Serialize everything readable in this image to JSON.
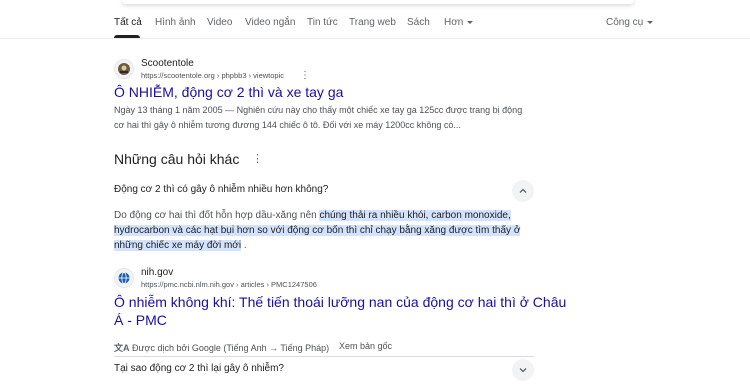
{
  "tabs": {
    "items": [
      {
        "label": "Tất cả"
      },
      {
        "label": "Hình ảnh"
      },
      {
        "label": "Video"
      },
      {
        "label": "Video ngắn"
      },
      {
        "label": "Tin tức"
      },
      {
        "label": "Trang web"
      },
      {
        "label": "Sách"
      },
      {
        "label": "Hơn"
      }
    ],
    "tools_label": "Công cụ"
  },
  "result1": {
    "site_name": "Scootentole",
    "url": "https://scootentole.org › phpbb3 › viewtopic",
    "title": "Ô NHIỄM, động cơ 2 thì và xe tay ga",
    "snippet_lines": [
      "Ngày 13 tháng 1 năm 2005 — Nghiên cứu này cho thấy một chiếc xe tay ga 125cc được trang bị động",
      "cơ hai thì gây ô nhiễm tương đương 144 chiếc ô tô. Đối với xe máy 1200cc không có..."
    ]
  },
  "paa": {
    "heading": "Những câu hỏi khác",
    "question1": "Động cơ 2 thì có gây ô nhiễm nhiều hơn không?",
    "answer": {
      "line1_plain": "Do động cơ hai thì đốt hỗn hợp dầu-xăng nên ",
      "line1_hl": "chúng thải ra nhiều khói, carbon monoxide,",
      "line2_hl": "hydrocarbon và các hạt bụi hơn so với động cơ bốn thì chỉ chạy bằng xăng được tìm thấy ở",
      "line3_hl": "những chiếc xe máy đời mới",
      "line3_tail": " ."
    },
    "source": {
      "site_name": "nih.gov",
      "url": "https://pmc.ncbi.nlm.nih.gov › articles › PMC1247506",
      "title_line1": "Ô nhiễm không khí: Thế tiến thoái lưỡng nan của động cơ hai thì ở Châu",
      "title_line2": "Á - PMC"
    },
    "translate_note": "Được dịch bởi Google (Tiếng Anh → Tiếng Pháp)",
    "see_original": "Xem bản gốc",
    "question2": "Tại sao động cơ 2 thì lại gây ô nhiễm?"
  },
  "colors": {
    "link": "#1a0dab",
    "highlight": "#d3e3fd",
    "text": "#202124",
    "secondary": "#4d5156"
  }
}
